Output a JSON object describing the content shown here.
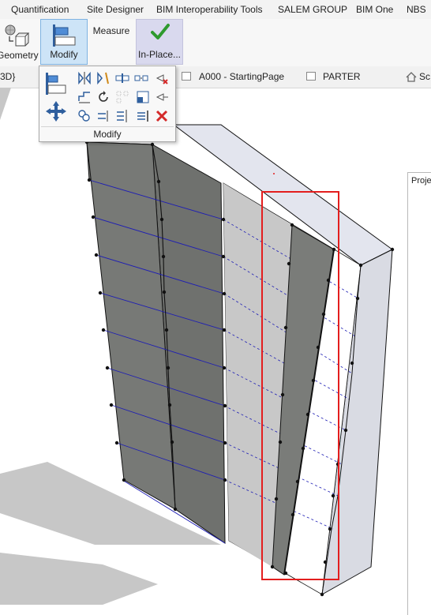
{
  "ribbon": {
    "tabs": [
      "Quantification",
      "Site Designer",
      "BIM Interoperability Tools",
      "SALEM GROUP",
      "BIM One",
      "NBS"
    ],
    "buttons": {
      "geometry": "Geometry",
      "modify": "Modify",
      "measure": "Measure",
      "in_place": "In-Place..."
    }
  },
  "flyout": {
    "panel_label": "Modify"
  },
  "view_tabs": {
    "view_3d": "3D}",
    "starting_page": "A000 - StartingPage",
    "parter": "PARTER",
    "partial": "Sc"
  },
  "project_browser": {
    "title": "Proje"
  },
  "colors": {
    "selection_box": "#e31e1e",
    "active_button": "#cde4f7",
    "wall_dark": "#787878",
    "grid_lines": "#1e1eb4"
  }
}
